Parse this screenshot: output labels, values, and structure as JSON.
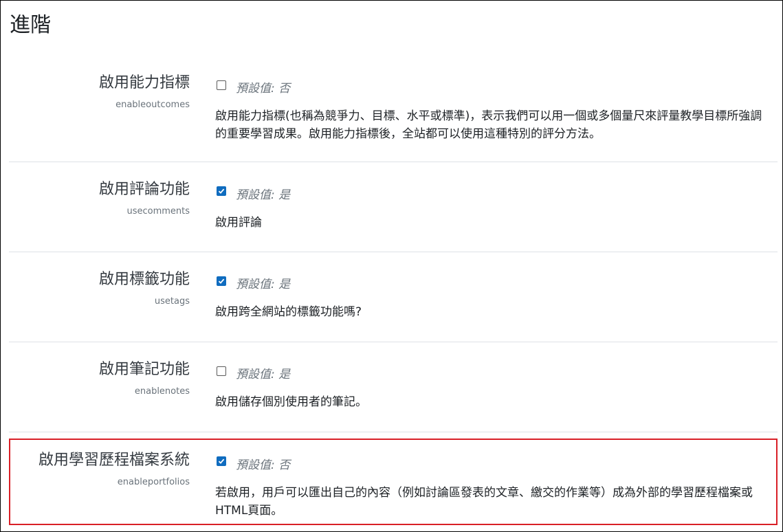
{
  "section": {
    "title": "進階"
  },
  "settings": [
    {
      "visible_name": "啟用能力指標",
      "internal_name": "enableoutcomes",
      "checked": false,
      "default_label": "預設值: 否",
      "description": "啟用能力指標(也稱為競爭力、目標、水平或標準)，表示我們可以用一個或多個量尺來評量教學目標所強調的重要學習成果。啟用能力指標後，全站都可以使用這種特別的評分方法。"
    },
    {
      "visible_name": "啟用評論功能",
      "internal_name": "usecomments",
      "checked": true,
      "default_label": "預設值: 是",
      "description": "啟用評論"
    },
    {
      "visible_name": "啟用標籤功能",
      "internal_name": "usetags",
      "checked": true,
      "default_label": "預設值: 是",
      "description": "啟用跨全網站的標籤功能嗎?"
    },
    {
      "visible_name": "啟用筆記功能",
      "internal_name": "enablenotes",
      "checked": false,
      "default_label": "預設值: 是",
      "description": "啟用儲存個別使用者的筆記。"
    },
    {
      "visible_name": "啟用學習歷程檔案系統",
      "internal_name": "enableportfolios",
      "checked": true,
      "default_label": "預設值: 否",
      "description": "若啟用，用戶可以匯出自己的內容（例如討論區發表的文章、繳交的作業等）成為外部的學習歷程檔案或HTML頁面。"
    }
  ],
  "colors": {
    "checkbox_checked": "#0f6cbf",
    "highlight_border": "#d91f26",
    "divider": "#dee2e6",
    "muted_text": "#6a737b"
  },
  "icons": {
    "checkmark": "check-icon"
  }
}
